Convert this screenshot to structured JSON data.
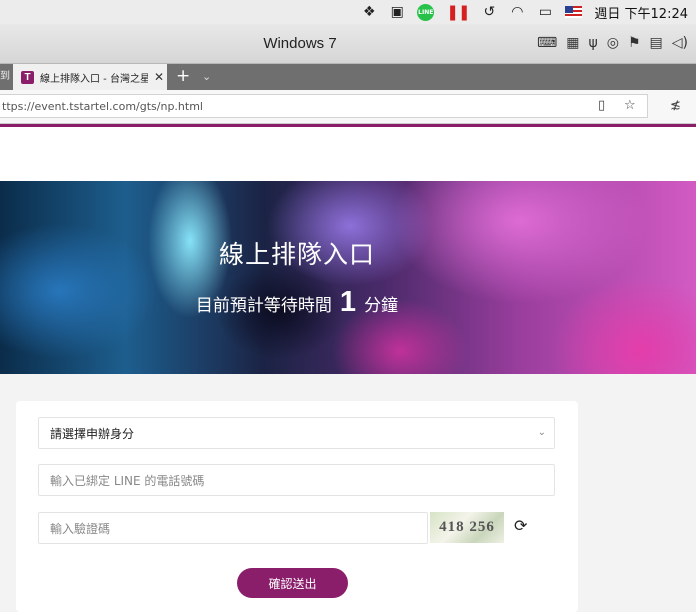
{
  "menubar": {
    "icons": [
      "dropbox-icon",
      "clipboard-icon",
      "line-icon",
      "pause-icon",
      "time-machine-icon",
      "wifi-icon",
      "airplay-icon",
      "flag-icon"
    ],
    "line_badge": "LINE",
    "clock": "週日 下午12:24"
  },
  "vm": {
    "title": "Windows 7"
  },
  "browser": {
    "prev_tab_fragment": "到",
    "tab": {
      "favicon": "T",
      "label": "線上排隊入口 - 台灣之星"
    },
    "url": "ttps://event.tstartel.com/gts/np.html"
  },
  "banner": {
    "title": "線上排隊入口",
    "wait_prefix": "目前預計等待時間",
    "wait_minutes": "1",
    "wait_unit": "分鐘"
  },
  "form": {
    "identity_select": "請選擇申辦身分",
    "phone_placeholder": "輸入已綁定 LINE 的電話號碼",
    "captcha_placeholder": "輸入驗證碼",
    "captcha_text": "418 256",
    "submit_label": "確認送出"
  },
  "colors": {
    "brand": "#8a1e6b"
  }
}
